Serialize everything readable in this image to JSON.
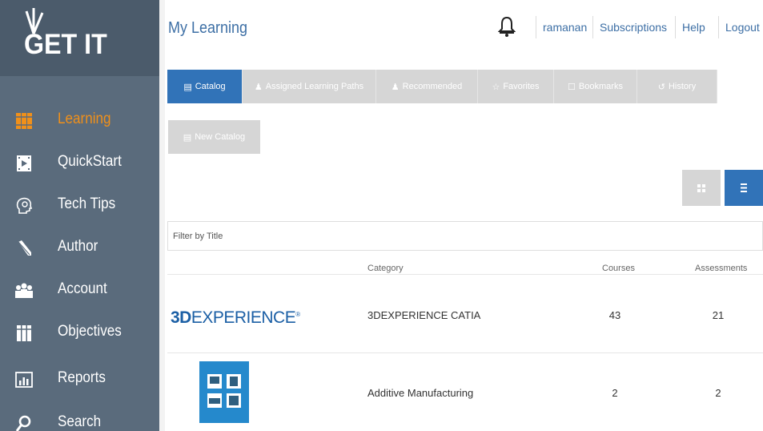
{
  "sidebar": {
    "logo_text": "GET IT",
    "items": [
      {
        "label": "Learning",
        "icon": "catalog-books-icon",
        "active": true
      },
      {
        "label": "QuickStart",
        "icon": "film-icon"
      },
      {
        "label": "Tech Tips",
        "icon": "head-lightbulb-icon"
      },
      {
        "label": "Author",
        "icon": "pencil-icon"
      },
      {
        "label": "Account",
        "icon": "users-icon"
      },
      {
        "label": "Objectives",
        "icon": "objectives-icon"
      },
      {
        "label": "Reports",
        "icon": "bar-chart-icon"
      },
      {
        "label": "Search",
        "icon": "search-icon"
      }
    ]
  },
  "header": {
    "title": "My Learning",
    "links": [
      "ramanan",
      "Subscriptions",
      "Help",
      "Logout"
    ]
  },
  "tabs": [
    {
      "label": "Catalog",
      "icon": "catalog-icon",
      "active": true
    },
    {
      "label": "Assigned Learning Paths",
      "icon": "assigned-paths-icon"
    },
    {
      "label": "Recommended",
      "icon": "recommended-icon"
    },
    {
      "label": "Favorites",
      "icon": "star-icon"
    },
    {
      "label": "Bookmarks",
      "icon": "bookmark-icon"
    },
    {
      "label": "History",
      "icon": "history-icon"
    }
  ],
  "new_catalog_label": "New Catalog",
  "filter": {
    "placeholder": "Filter by Title"
  },
  "table": {
    "headers": {
      "category": "Category",
      "courses": "Courses",
      "assessments": "Assessments"
    },
    "rows": [
      {
        "logo_bold": "3D",
        "logo_rest": "EXPERIENCE",
        "logo_mark": "®",
        "category": "3DEXPERIENCE CATIA",
        "courses": "43",
        "assessments": "21"
      },
      {
        "category": "Additive Manufacturing",
        "courses": "2",
        "assessments": "2"
      }
    ]
  },
  "colors": {
    "sidebar": "#5a6b7c",
    "accent_orange": "#f0901a",
    "primary_blue": "#3173b8",
    "link_blue": "#3d6fa5"
  }
}
